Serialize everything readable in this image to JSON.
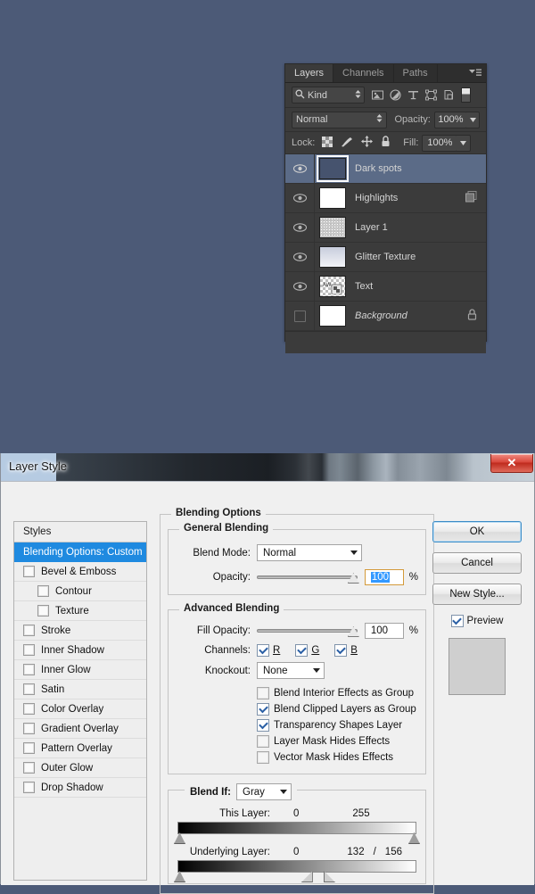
{
  "layers_panel": {
    "tabs": [
      {
        "label": "Layers",
        "active": true
      },
      {
        "label": "Channels",
        "active": false
      },
      {
        "label": "Paths",
        "active": false
      }
    ],
    "menu_icon": "panel-menu-icon",
    "filter": {
      "search_icon": "search-icon",
      "kind_label": "Kind",
      "stepper_icon": "stepper-icon",
      "filter_icons": [
        "image-filter-icon",
        "adjustment-filter-icon",
        "text-filter-icon",
        "shape-filter-icon",
        "smart-object-filter-icon"
      ],
      "toggle_icon": "filter-toggle-switch"
    },
    "blend": {
      "mode": "Normal",
      "opacity_label": "Opacity:",
      "opacity_value": "100%"
    },
    "lock": {
      "label": "Lock:",
      "icons": [
        "lock-transparency-icon",
        "lock-image-icon",
        "lock-position-icon",
        "lock-all-icon"
      ],
      "fill_label": "Fill:",
      "fill_value": "100%"
    },
    "layers": [
      {
        "name": "Dark spots",
        "visible": true,
        "selected": true,
        "thumb": "solid-navy",
        "italic": false,
        "badge": ""
      },
      {
        "name": "Highlights",
        "visible": true,
        "selected": false,
        "thumb": "solid-white",
        "italic": false,
        "badge": "clipping-mask-icon"
      },
      {
        "name": "Layer 1",
        "visible": true,
        "selected": false,
        "thumb": "noise-gray",
        "italic": false,
        "badge": ""
      },
      {
        "name": "Glitter Texture",
        "visible": true,
        "selected": false,
        "thumb": "gradient-gray",
        "italic": false,
        "badge": ""
      },
      {
        "name": "Text",
        "visible": true,
        "selected": false,
        "thumb": "checker-text",
        "italic": false,
        "badge": ""
      },
      {
        "name": "Background",
        "visible": false,
        "selected": false,
        "thumb": "solid-white",
        "italic": true,
        "badge": "lock-icon"
      }
    ]
  },
  "dialog": {
    "title": "Layer Style",
    "close_label": "✕",
    "styles": {
      "header": "Styles",
      "items": [
        {
          "label": "Blending Options: Custom",
          "active": true,
          "checkbox": false,
          "checked": false,
          "indent": false
        },
        {
          "label": "Bevel & Emboss",
          "active": false,
          "checkbox": true,
          "checked": false,
          "indent": false
        },
        {
          "label": "Contour",
          "active": false,
          "checkbox": true,
          "checked": false,
          "indent": true
        },
        {
          "label": "Texture",
          "active": false,
          "checkbox": true,
          "checked": false,
          "indent": true
        },
        {
          "label": "Stroke",
          "active": false,
          "checkbox": true,
          "checked": false,
          "indent": false
        },
        {
          "label": "Inner Shadow",
          "active": false,
          "checkbox": true,
          "checked": false,
          "indent": false
        },
        {
          "label": "Inner Glow",
          "active": false,
          "checkbox": true,
          "checked": false,
          "indent": false
        },
        {
          "label": "Satin",
          "active": false,
          "checkbox": true,
          "checked": false,
          "indent": false
        },
        {
          "label": "Color Overlay",
          "active": false,
          "checkbox": true,
          "checked": false,
          "indent": false
        },
        {
          "label": "Gradient Overlay",
          "active": false,
          "checkbox": true,
          "checked": false,
          "indent": false
        },
        {
          "label": "Pattern Overlay",
          "active": false,
          "checkbox": true,
          "checked": false,
          "indent": false
        },
        {
          "label": "Outer Glow",
          "active": false,
          "checkbox": true,
          "checked": false,
          "indent": false
        },
        {
          "label": "Drop Shadow",
          "active": false,
          "checkbox": true,
          "checked": false,
          "indent": false
        }
      ]
    },
    "blending_options": {
      "legend": "Blending Options",
      "general": {
        "legend": "General Blending",
        "blend_mode_label": "Blend Mode:",
        "blend_mode_value": "Normal",
        "opacity_label": "Opacity:",
        "opacity_value": "100",
        "opacity_percent": "%",
        "opacity_slider_pct": 100
      },
      "advanced": {
        "legend": "Advanced Blending",
        "fill_opacity_label": "Fill Opacity:",
        "fill_opacity_value": "100",
        "fill_opacity_percent": "%",
        "fill_opacity_slider_pct": 100,
        "channels_label": "Channels:",
        "channels": [
          {
            "label": "R",
            "checked": true
          },
          {
            "label": "G",
            "checked": true
          },
          {
            "label": "B",
            "checked": true
          }
        ],
        "knockout_label": "Knockout:",
        "knockout_value": "None",
        "checkboxes": [
          {
            "label": "Blend Interior Effects as Group",
            "checked": false
          },
          {
            "label": "Blend Clipped Layers as Group",
            "checked": true
          },
          {
            "label": "Transparency Shapes Layer",
            "checked": true
          },
          {
            "label": "Layer Mask Hides Effects",
            "checked": false
          },
          {
            "label": "Vector Mask Hides Effects",
            "checked": false
          }
        ]
      },
      "blend_if": {
        "label": "Blend If:",
        "channel": "Gray",
        "this_layer": {
          "label": "This Layer:",
          "low": "0",
          "high": "255",
          "low_pct": 0,
          "high_pct": 100
        },
        "underlying_layer": {
          "label": "Underlying Layer:",
          "low": "0",
          "high_a": "132",
          "separator": "/",
          "high_b": "156",
          "low_pct": 0,
          "high_a_pct": 51.8,
          "high_b_pct": 61.2
        }
      }
    },
    "buttons": {
      "ok": "OK",
      "cancel": "Cancel",
      "new_style": "New Style...",
      "preview_label": "Preview",
      "preview_checked": true
    }
  },
  "colors": {
    "desktop": "#4c5a77",
    "panel_bg": "#3b3b3b",
    "selected_layer": "#5b6b87",
    "accent_blue": "#1f8ae0",
    "dialog_bg": "#f0f0f0"
  }
}
